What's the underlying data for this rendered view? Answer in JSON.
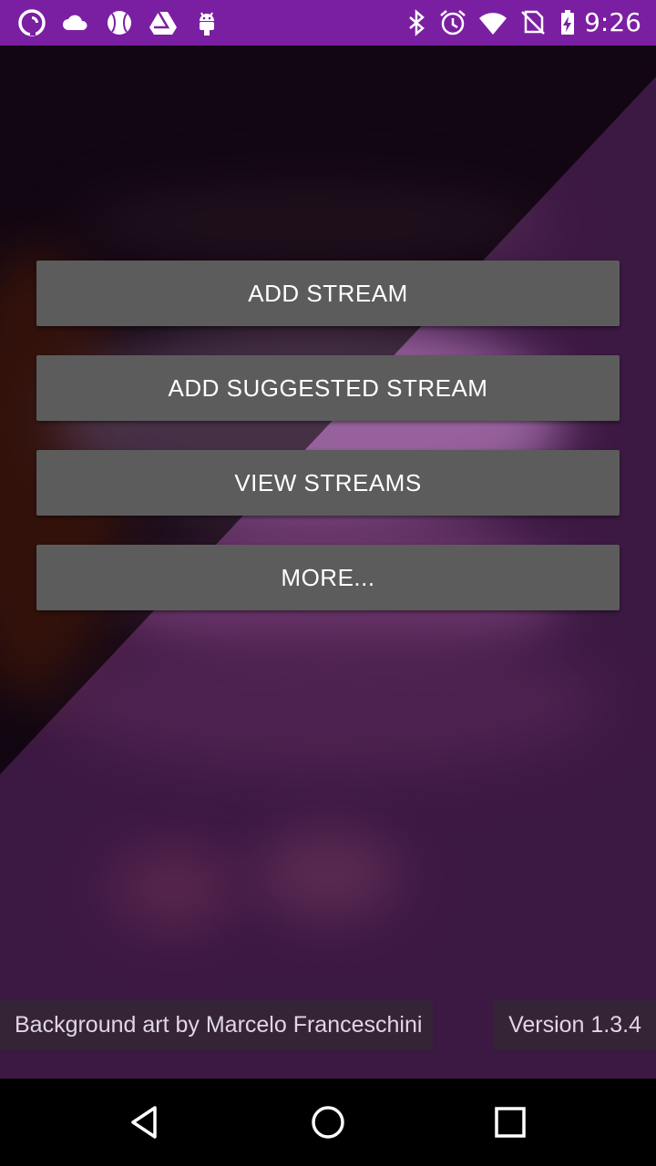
{
  "status_bar": {
    "time": "9:26",
    "background": "#7b1fa2",
    "left_icons": [
      "pocket-casts-icon",
      "cloud-icon",
      "baseball-icon",
      "drive-icon",
      "android-icon"
    ],
    "right_icons": [
      "bluetooth-icon",
      "alarm-icon",
      "wifi-icon",
      "no-sim-icon",
      "battery-charging-icon"
    ]
  },
  "menu": {
    "buttons": [
      {
        "label": "ADD STREAM"
      },
      {
        "label": "ADD SUGGESTED STREAM"
      },
      {
        "label": "VIEW STREAMS"
      },
      {
        "label": "MORE..."
      }
    ],
    "button_color": "#5c5c5c"
  },
  "footer": {
    "credit": "Background art by Marcelo Franceschini",
    "version": "Version 1.3.4"
  },
  "nav_bar": {
    "icons": [
      "back-icon",
      "home-icon",
      "recents-icon"
    ]
  }
}
